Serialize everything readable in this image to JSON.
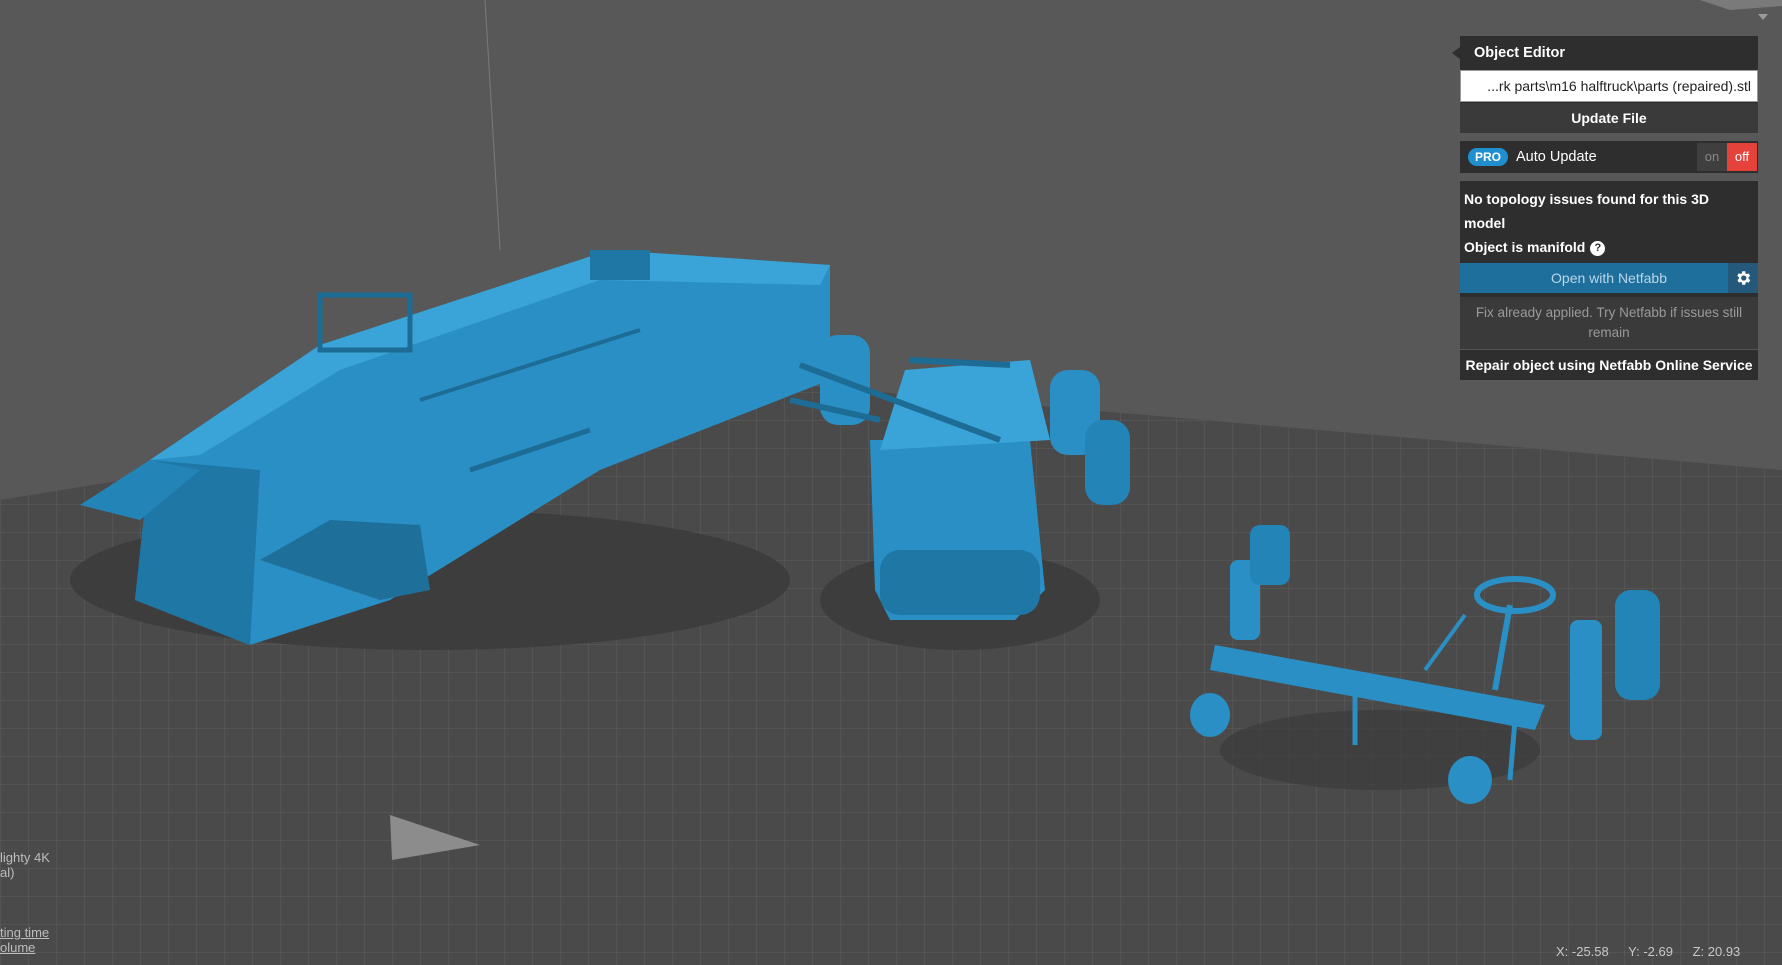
{
  "object_editor": {
    "title": "Object Editor",
    "file_path": "...rk parts\\m16 halftruck\\parts (repaired).stl",
    "update_label": "Update File"
  },
  "auto_update": {
    "badge": "PRO",
    "label": "Auto Update",
    "on_label": "on",
    "off_label": "off",
    "state": "off"
  },
  "topology": {
    "status": "No topology issues found for this 3D model",
    "manifold": "Object is manifold",
    "open_netfabb": "Open with Netfabb",
    "fix_note": "Fix already applied. Try Netfabb if issues still remain",
    "repair_label": "Repair object using Netfabb Online Service"
  },
  "printer_info": {
    "line1": "lighty 4K",
    "line2": "al)"
  },
  "estimates": {
    "time_link": "ting time",
    "volume_link": "olume"
  },
  "cursor_coords": {
    "x": "X: -25.58",
    "y": "Y: -2.69",
    "z": "Z: 20.93"
  },
  "colors": {
    "model": "#2a8fc4",
    "background": "#585858",
    "accent": "#1f8fd0",
    "off_toggle": "#e4423a"
  }
}
